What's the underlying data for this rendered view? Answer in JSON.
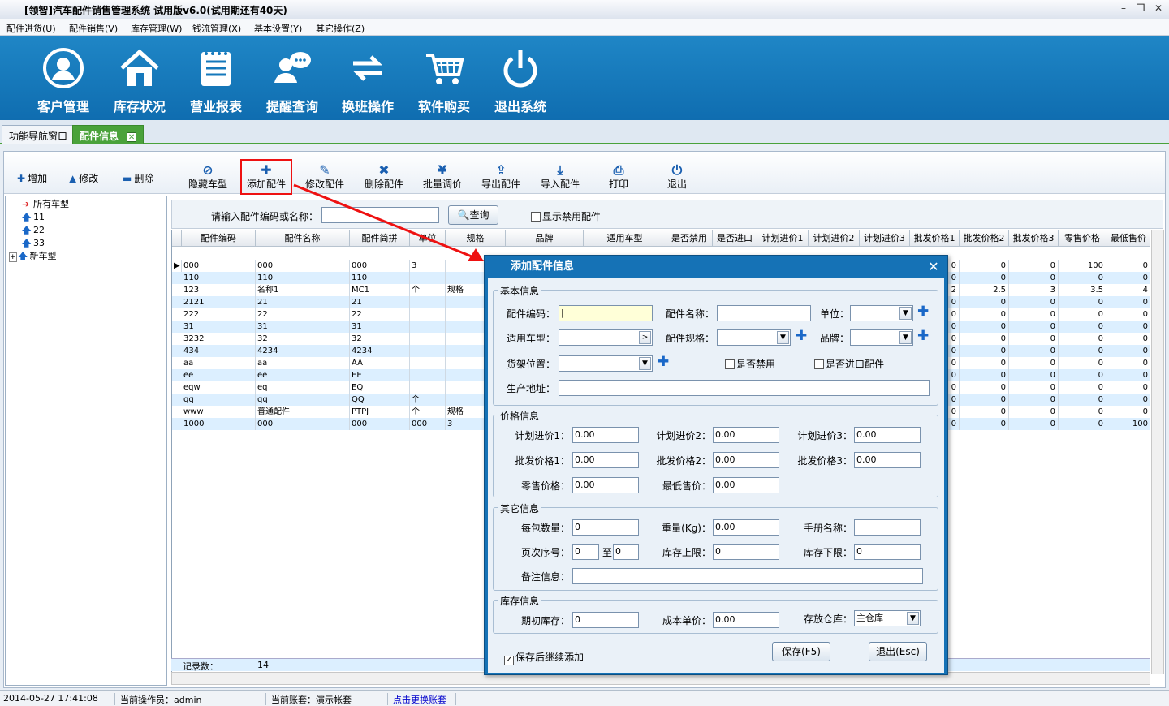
{
  "window": {
    "title": "[领智]汽车配件销售管理系统  试用版v6.0(试用期还有40天)"
  },
  "menu": [
    "配件进货(U)",
    "配件销售(V)",
    "库存管理(W)",
    "钱流管理(X)",
    "基本设置(Y)",
    "其它操作(Z)"
  ],
  "ribbon": [
    "客户管理",
    "库存状况",
    "营业报表",
    "提醒查询",
    "换班操作",
    "软件购买",
    "退出系统"
  ],
  "tabs": {
    "nav": "功能导航窗口",
    "active": "配件信息"
  },
  "toolbar": {
    "left": [
      "增加",
      "修改",
      "删除"
    ],
    "buttons": [
      "隐藏车型",
      "添加配件",
      "修改配件",
      "删除配件",
      "批量调价",
      "导出配件",
      "导入配件",
      "打印",
      "退出"
    ]
  },
  "tree": {
    "root": "所有车型",
    "children": [
      "11",
      "22",
      "33",
      "新车型"
    ]
  },
  "search": {
    "label": "请输入配件编码或名称：",
    "button": "查询",
    "checkbox": "显示禁用配件"
  },
  "grid": {
    "headers": [
      "配件编码",
      "配件名称",
      "配件简拼",
      "单位",
      "规格",
      "品牌",
      "适用车型",
      "是否禁用",
      "是否进口",
      "计划进价1",
      "计划进价2",
      "计划进价3",
      "批发价格1",
      "批发价格2",
      "批发价格3",
      "零售价格",
      "最低售价"
    ],
    "rows": [
      {
        "code": "000",
        "name": "000",
        "abbr": "000",
        "unit": "3",
        "spec": "",
        "p1": "0",
        "p2": "0",
        "p3": "0",
        "retail": "100",
        "min": "0"
      },
      {
        "code": "110",
        "name": "110",
        "abbr": "110",
        "unit": "",
        "spec": "",
        "p1": "0",
        "p2": "0",
        "p3": "0",
        "retail": "0",
        "min": "0"
      },
      {
        "code": "123",
        "name": "名称1",
        "abbr": "MC1",
        "unit": "个",
        "spec": "规格",
        "p1": "2",
        "p2": "2.5",
        "p3": "3",
        "retail": "3.5",
        "min": "4"
      },
      {
        "code": "2121",
        "name": "21",
        "abbr": "21",
        "unit": "",
        "spec": "",
        "p1": "0",
        "p2": "0",
        "p3": "0",
        "retail": "0",
        "min": "0"
      },
      {
        "code": "222",
        "name": "22",
        "abbr": "22",
        "unit": "",
        "spec": "",
        "p1": "0",
        "p2": "0",
        "p3": "0",
        "retail": "0",
        "min": "0"
      },
      {
        "code": "31",
        "name": "31",
        "abbr": "31",
        "unit": "",
        "spec": "",
        "p1": "0",
        "p2": "0",
        "p3": "0",
        "retail": "0",
        "min": "0"
      },
      {
        "code": "3232",
        "name": "32",
        "abbr": "32",
        "unit": "",
        "spec": "",
        "p1": "0",
        "p2": "0",
        "p3": "0",
        "retail": "0",
        "min": "0"
      },
      {
        "code": "434",
        "name": "4234",
        "abbr": "4234",
        "unit": "",
        "spec": "",
        "p1": "0",
        "p2": "0",
        "p3": "0",
        "retail": "0",
        "min": "0"
      },
      {
        "code": "aa",
        "name": "aa",
        "abbr": "AA",
        "unit": "",
        "spec": "",
        "p1": "0",
        "p2": "0",
        "p3": "0",
        "retail": "0",
        "min": "0"
      },
      {
        "code": "ee",
        "name": "ee",
        "abbr": "EE",
        "unit": "",
        "spec": "",
        "p1": "0",
        "p2": "0",
        "p3": "0",
        "retail": "0",
        "min": "0"
      },
      {
        "code": "eqw",
        "name": "eq",
        "abbr": "EQ",
        "unit": "",
        "spec": "",
        "p1": "0",
        "p2": "0",
        "p3": "0",
        "retail": "0",
        "min": "0"
      },
      {
        "code": "qq",
        "name": "qq",
        "abbr": "QQ",
        "unit": "个",
        "spec": "",
        "p1": "0",
        "p2": "0",
        "p3": "0",
        "retail": "0",
        "min": "0"
      },
      {
        "code": "www",
        "name": "普通配件",
        "abbr": "PTPJ",
        "unit": "个",
        "spec": "规格",
        "p1": "0",
        "p2": "0",
        "p3": "0",
        "retail": "0",
        "min": "0"
      },
      {
        "code": "1000",
        "name": "000",
        "abbr": "000",
        "unit": "000",
        "spec": "3",
        "p1": "0",
        "p2": "0",
        "p3": "0",
        "retail": "0",
        "min": "100"
      }
    ],
    "footer_label": "记录数：",
    "footer_count": "14"
  },
  "status": {
    "datetime": "2014-05-27 17:41:08",
    "operator": "当前操作员：admin",
    "account": "当前账套：演示帐套",
    "switch_link": "点击更换账套"
  },
  "dialog": {
    "title": "添加配件信息",
    "groups": {
      "basic": "基本信息",
      "price": "价格信息",
      "other": "其它信息",
      "stock": "库存信息"
    },
    "labels": {
      "code": "配件编码：",
      "name": "配件名称：",
      "unit": "单位：",
      "car": "适用车型：",
      "spec": "配件规格：",
      "brand": "品牌：",
      "shelf": "货架位置：",
      "disabled": "是否禁用",
      "imported": "是否进口配件",
      "origin": "生产地址：",
      "plan1": "计划进价1：",
      "plan2": "计划进价2：",
      "plan3": "计划进价3：",
      "whole1": "批发价格1：",
      "whole2": "批发价格2：",
      "whole3": "批发价格3：",
      "retail": "零售价格：",
      "minprice": "最低售价：",
      "perpack": "每包数量：",
      "weight": "重量(Kg)：",
      "manual": "手册名称：",
      "page": "页次序号：",
      "to": "至",
      "upper": "库存上限：",
      "lower": "库存下限：",
      "note": "备注信息：",
      "initstock": "期初库存：",
      "cost": "成本单价：",
      "warehouse": "存放仓库："
    },
    "values": {
      "plan1": "0.00",
      "plan2": "0.00",
      "plan3": "0.00",
      "whole1": "0.00",
      "whole2": "0.00",
      "whole3": "0.00",
      "retail": "0.00",
      "minprice": "0.00",
      "perpack": "0",
      "weight": "0.00",
      "page_from": "0",
      "page_to": "0",
      "upper": "0",
      "lower": "0",
      "initstock": "0",
      "cost": "0.00",
      "warehouse": "主仓库"
    },
    "continue_label": "保存后继续添加",
    "save": "保存(F5)",
    "exit": "退出(Esc)"
  },
  "colors": {
    "ribbon": "#1578bb",
    "dialog": "#1572b6",
    "highlight": "#ee1111",
    "tab_active": "#4aa23a"
  }
}
